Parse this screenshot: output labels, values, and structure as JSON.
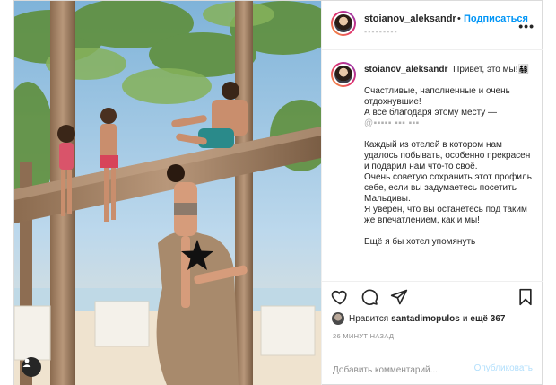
{
  "post": {
    "username": "stoianov_aleksandr",
    "separator": "•",
    "follow_label": "Подписаться",
    "location_text": "▪▪▪▪▪▪▪▪▪",
    "more_label": "•••"
  },
  "caption": {
    "username": "stoianov_aleksandr",
    "greeting": "Привет, это мы!",
    "greeting_emoji": "👨‍👩‍👧‍👦",
    "p1_line1": "Счастливые, наполненные и очень отдохнувшие!",
    "p1_line2": "А всё благодаря этому месту —",
    "p1_blurred": "@▪▪▪▪▪ ▪▪▪ ▪▪▪",
    "p2": "Каждый из отелей в котором нам удалось побывать, особенно прекрасен и подарил нам что-то своё.",
    "p3": "Очень советую сохранить этот профиль себе, если вы задумаетесь посетить Мальдивы.",
    "p4": "Я уверен, что вы останетесь под таким же впечатлением, как и мы!",
    "p5": "Ещё я бы хотел упомянуть"
  },
  "likes": {
    "prefix": "Нравится",
    "user": "santadimopulos",
    "and": "и",
    "count_text": "ещё 367"
  },
  "time_ago": "26 МИНУТ НАЗАД",
  "comment": {
    "placeholder": "Добавить комментарий...",
    "publish_label": "Опубликовать"
  },
  "colors": {
    "link_blue": "#0095f6",
    "publish_disabled": "#b2dffc",
    "border": "#dbdbdb",
    "text": "#262626",
    "muted": "#8e8e8e"
  },
  "icons": [
    "heart-icon",
    "comment-icon",
    "share-icon",
    "bookmark-icon",
    "more-icon",
    "user-tag-icon",
    "star-icon"
  ]
}
